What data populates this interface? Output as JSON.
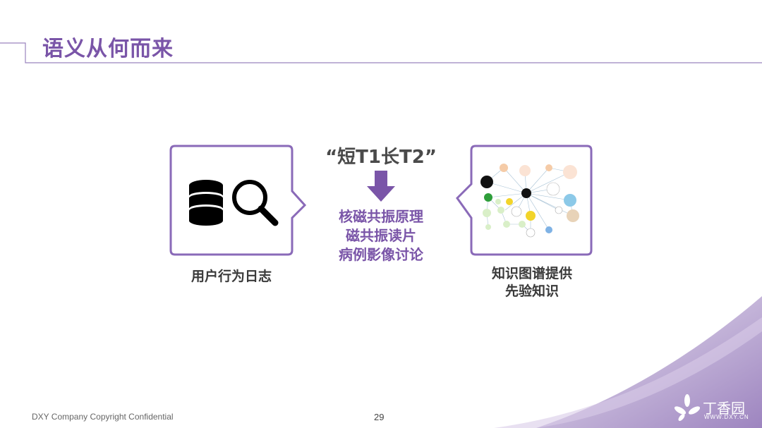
{
  "header": {
    "title": "语义从何而来"
  },
  "left_panel": {
    "caption": "用户行为日志",
    "icons": [
      "database-icon",
      "magnifier-icon"
    ]
  },
  "center": {
    "quote": "“短T1长T2”",
    "arrow_icon": "down-arrow-icon",
    "topics": [
      "核磁共振原理",
      "磁共振读片",
      "病例影像讨论"
    ]
  },
  "right_panel": {
    "caption_lines": [
      "知识图谱提供",
      "先验知识"
    ],
    "image": "knowledge-graph-thumbnail"
  },
  "footer": {
    "copyright": "DXY Company Copyright Confidential",
    "page_number": "29"
  },
  "brand": {
    "name": "丁香园",
    "url": "WWW.DXY.CN"
  },
  "colors": {
    "accent": "#7a55a8",
    "text": "#3a3a3a",
    "frame": "#8a6ab8"
  }
}
